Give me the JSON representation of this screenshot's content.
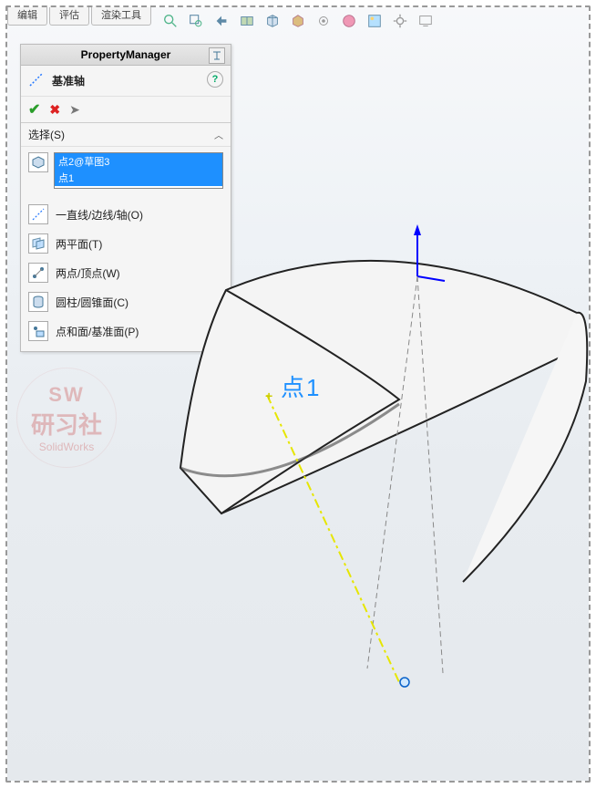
{
  "tabs": {
    "t0": "编辑",
    "t1": "评估",
    "t2": "渲染工具"
  },
  "panel": {
    "title": "PropertyManager",
    "feature_name": "基准轴",
    "help": "?",
    "section_select": "选择(S)",
    "chev": "︿",
    "sel_items": {
      "i0": "点2@草图3",
      "i1": "点1"
    },
    "options": {
      "o0": "一直线/边线/轴(O)",
      "o1": "两平面(T)",
      "o2": "两点/顶点(W)",
      "o3": "圆柱/圆锥面(C)",
      "o4": "点和面/基准面(P)"
    }
  },
  "watermark": {
    "top": "SW",
    "mid": "研习社",
    "bot": "SolidWorks"
  },
  "labels": {
    "point1": "点1",
    "plus": "+"
  }
}
